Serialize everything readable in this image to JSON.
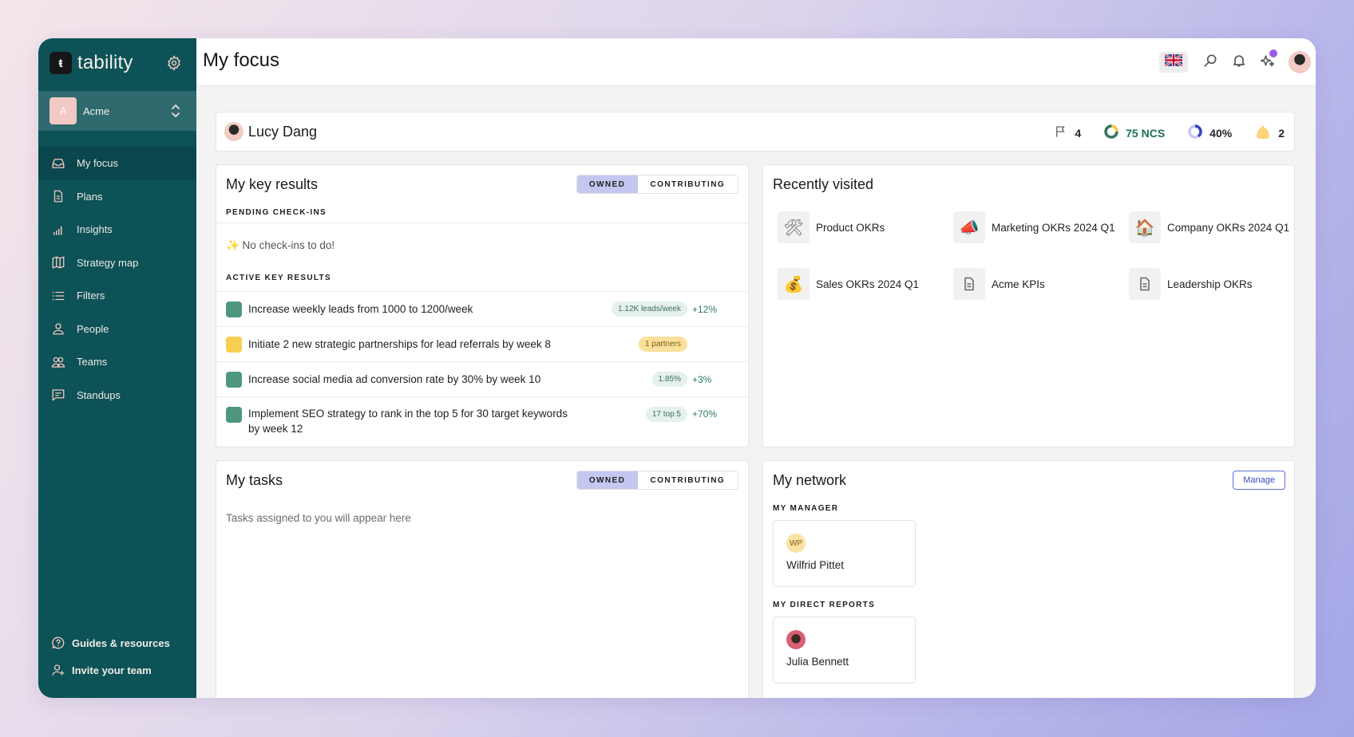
{
  "app": {
    "brand_name": "tability",
    "brand_logo_glyph": "ŧ",
    "workspace": {
      "avatar_letter": "A",
      "name": "Acme"
    }
  },
  "sidebar": {
    "items": [
      {
        "label": "My focus",
        "icon": "inbox-icon",
        "active": true
      },
      {
        "label": "Plans",
        "icon": "document-icon"
      },
      {
        "label": "Insights",
        "icon": "bar-chart-icon"
      },
      {
        "label": "Strategy map",
        "icon": "map-icon"
      },
      {
        "label": "Filters",
        "icon": "list-icon"
      },
      {
        "label": "People",
        "icon": "person-icon"
      },
      {
        "label": "Teams",
        "icon": "team-icon"
      },
      {
        "label": "Standups",
        "icon": "chat-icon"
      }
    ],
    "bottom": [
      {
        "label": "Guides & resources",
        "icon": "help-icon"
      },
      {
        "label": "Invite your team",
        "icon": "user-plus-icon"
      }
    ]
  },
  "header": {
    "title": "My focus",
    "language_flag": "uk-flag"
  },
  "user_strip": {
    "name": "Lucy Dang",
    "stats": {
      "flags": "4",
      "ncs": "75 NCS",
      "progress": "40%",
      "progress_value": 0.4,
      "ncs_value": 75,
      "confidence": "2"
    },
    "colors": {
      "ncs": "#1f6f5a",
      "progress": "#3b44c4",
      "confidence": "#fdd47a"
    }
  },
  "key_results": {
    "title": "My key results",
    "tabs": [
      "OWNED",
      "CONTRIBUTING"
    ],
    "active_tab": "OWNED",
    "pending_label": "PENDING CHECK-INS",
    "pending_empty": "✨ No check-ins to do!",
    "active_label": "ACTIVE KEY RESULTS",
    "items": [
      {
        "title": "Increase weekly leads from 1000 to 1200/week",
        "status_color": "#4e9680",
        "value": "1.12K leads/week",
        "delta": "+12%"
      },
      {
        "title": "Initiate 2 new strategic partnerships for lead referrals by week 8",
        "status_color": "#f8cf52",
        "value": "1 partners",
        "delta": ""
      },
      {
        "title": "Increase social media ad conversion rate by 30% by week 10",
        "status_color": "#4e9680",
        "value": "1.85%",
        "delta": "+3%"
      },
      {
        "title": "Implement SEO strategy to rank in the top 5 for 30 target keywords by week 12",
        "status_color": "#4e9680",
        "value": "17 top 5",
        "delta": "+70%"
      }
    ]
  },
  "recently_visited": {
    "title": "Recently visited",
    "items": [
      {
        "label": "Product OKRs",
        "icon": "🛠"
      },
      {
        "label": "Marketing OKRs 2024 Q1",
        "icon": "📣"
      },
      {
        "label": "Company OKRs 2024 Q1",
        "icon": "🏠"
      },
      {
        "label": "Sales OKRs 2024 Q1",
        "icon": "💰"
      },
      {
        "label": "Acme KPIs",
        "icon": "document-icon"
      },
      {
        "label": "Leadership OKRs",
        "icon": "document-icon"
      }
    ]
  },
  "tasks": {
    "title": "My tasks",
    "tabs": [
      "OWNED",
      "CONTRIBUTING"
    ],
    "active_tab": "OWNED",
    "empty": "Tasks assigned to you will appear here"
  },
  "network": {
    "title": "My network",
    "manage_label": "Manage",
    "manager_label": "MY MANAGER",
    "manager": {
      "initials": "WP",
      "name": "Wilfrid Pittet"
    },
    "reports_label": "MY DIRECT REPORTS",
    "reports": [
      {
        "name": "Julia Bennett"
      }
    ]
  }
}
